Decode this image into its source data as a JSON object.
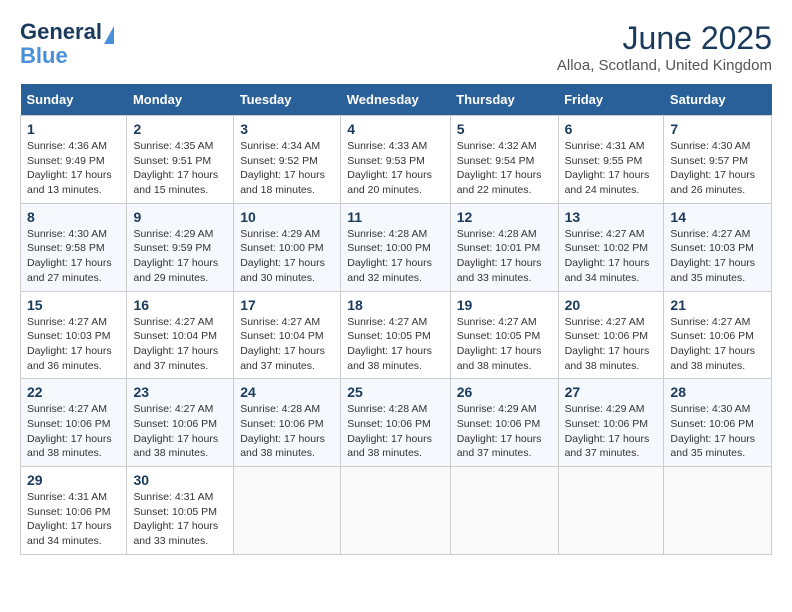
{
  "logo": {
    "general": "General",
    "blue": "Blue"
  },
  "title": "June 2025",
  "location": "Alloa, Scotland, United Kingdom",
  "days_of_week": [
    "Sunday",
    "Monday",
    "Tuesday",
    "Wednesday",
    "Thursday",
    "Friday",
    "Saturday"
  ],
  "weeks": [
    [
      {
        "day": "1",
        "info": "Sunrise: 4:36 AM\nSunset: 9:49 PM\nDaylight: 17 hours and 13 minutes."
      },
      {
        "day": "2",
        "info": "Sunrise: 4:35 AM\nSunset: 9:51 PM\nDaylight: 17 hours and 15 minutes."
      },
      {
        "day": "3",
        "info": "Sunrise: 4:34 AM\nSunset: 9:52 PM\nDaylight: 17 hours and 18 minutes."
      },
      {
        "day": "4",
        "info": "Sunrise: 4:33 AM\nSunset: 9:53 PM\nDaylight: 17 hours and 20 minutes."
      },
      {
        "day": "5",
        "info": "Sunrise: 4:32 AM\nSunset: 9:54 PM\nDaylight: 17 hours and 22 minutes."
      },
      {
        "day": "6",
        "info": "Sunrise: 4:31 AM\nSunset: 9:55 PM\nDaylight: 17 hours and 24 minutes."
      },
      {
        "day": "7",
        "info": "Sunrise: 4:30 AM\nSunset: 9:57 PM\nDaylight: 17 hours and 26 minutes."
      }
    ],
    [
      {
        "day": "8",
        "info": "Sunrise: 4:30 AM\nSunset: 9:58 PM\nDaylight: 17 hours and 27 minutes."
      },
      {
        "day": "9",
        "info": "Sunrise: 4:29 AM\nSunset: 9:59 PM\nDaylight: 17 hours and 29 minutes."
      },
      {
        "day": "10",
        "info": "Sunrise: 4:29 AM\nSunset: 10:00 PM\nDaylight: 17 hours and 30 minutes."
      },
      {
        "day": "11",
        "info": "Sunrise: 4:28 AM\nSunset: 10:00 PM\nDaylight: 17 hours and 32 minutes."
      },
      {
        "day": "12",
        "info": "Sunrise: 4:28 AM\nSunset: 10:01 PM\nDaylight: 17 hours and 33 minutes."
      },
      {
        "day": "13",
        "info": "Sunrise: 4:27 AM\nSunset: 10:02 PM\nDaylight: 17 hours and 34 minutes."
      },
      {
        "day": "14",
        "info": "Sunrise: 4:27 AM\nSunset: 10:03 PM\nDaylight: 17 hours and 35 minutes."
      }
    ],
    [
      {
        "day": "15",
        "info": "Sunrise: 4:27 AM\nSunset: 10:03 PM\nDaylight: 17 hours and 36 minutes."
      },
      {
        "day": "16",
        "info": "Sunrise: 4:27 AM\nSunset: 10:04 PM\nDaylight: 17 hours and 37 minutes."
      },
      {
        "day": "17",
        "info": "Sunrise: 4:27 AM\nSunset: 10:04 PM\nDaylight: 17 hours and 37 minutes."
      },
      {
        "day": "18",
        "info": "Sunrise: 4:27 AM\nSunset: 10:05 PM\nDaylight: 17 hours and 38 minutes."
      },
      {
        "day": "19",
        "info": "Sunrise: 4:27 AM\nSunset: 10:05 PM\nDaylight: 17 hours and 38 minutes."
      },
      {
        "day": "20",
        "info": "Sunrise: 4:27 AM\nSunset: 10:06 PM\nDaylight: 17 hours and 38 minutes."
      },
      {
        "day": "21",
        "info": "Sunrise: 4:27 AM\nSunset: 10:06 PM\nDaylight: 17 hours and 38 minutes."
      }
    ],
    [
      {
        "day": "22",
        "info": "Sunrise: 4:27 AM\nSunset: 10:06 PM\nDaylight: 17 hours and 38 minutes."
      },
      {
        "day": "23",
        "info": "Sunrise: 4:27 AM\nSunset: 10:06 PM\nDaylight: 17 hours and 38 minutes."
      },
      {
        "day": "24",
        "info": "Sunrise: 4:28 AM\nSunset: 10:06 PM\nDaylight: 17 hours and 38 minutes."
      },
      {
        "day": "25",
        "info": "Sunrise: 4:28 AM\nSunset: 10:06 PM\nDaylight: 17 hours and 38 minutes."
      },
      {
        "day": "26",
        "info": "Sunrise: 4:29 AM\nSunset: 10:06 PM\nDaylight: 17 hours and 37 minutes."
      },
      {
        "day": "27",
        "info": "Sunrise: 4:29 AM\nSunset: 10:06 PM\nDaylight: 17 hours and 37 minutes."
      },
      {
        "day": "28",
        "info": "Sunrise: 4:30 AM\nSunset: 10:06 PM\nDaylight: 17 hours and 35 minutes."
      }
    ],
    [
      {
        "day": "29",
        "info": "Sunrise: 4:31 AM\nSunset: 10:06 PM\nDaylight: 17 hours and 34 minutes."
      },
      {
        "day": "30",
        "info": "Sunrise: 4:31 AM\nSunset: 10:05 PM\nDaylight: 17 hours and 33 minutes."
      },
      {
        "day": "",
        "info": ""
      },
      {
        "day": "",
        "info": ""
      },
      {
        "day": "",
        "info": ""
      },
      {
        "day": "",
        "info": ""
      },
      {
        "day": "",
        "info": ""
      }
    ]
  ]
}
